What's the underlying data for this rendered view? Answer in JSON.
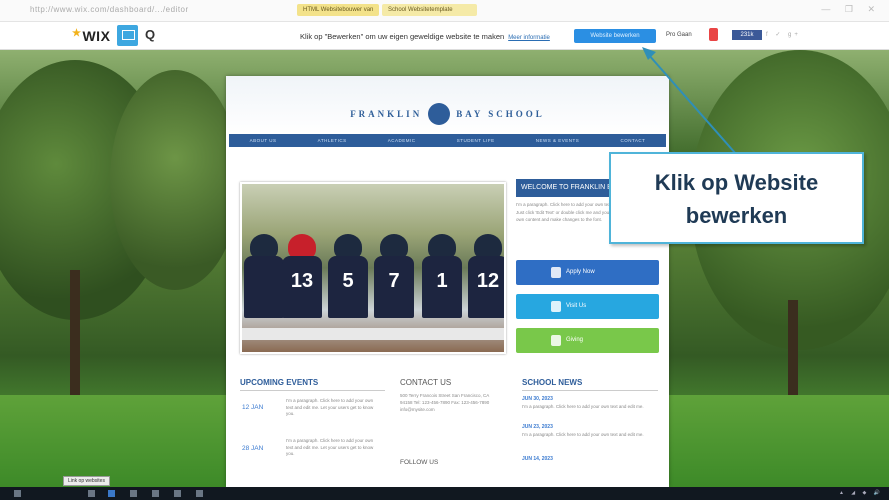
{
  "browser": {
    "url": "http://www.wix.com/dashboard/.../editor",
    "tab1": "HTML Websitebouwer van",
    "tab2": "School Websitetemplate",
    "window_controls": "— ❐ ✕"
  },
  "wix_bar": {
    "logo": "WIX",
    "q": "Q",
    "message": "Klik op \"Bewerken\" om uw eigen geweldige website te maken",
    "more_link": "Meer informatie",
    "edit_button": "Website bewerken",
    "premium": "Pro Gaan",
    "likes": "231k",
    "social": "f ✓ g+"
  },
  "site": {
    "brand_left": "FRANKLIN",
    "brand_right": "BAY SCHOOL",
    "nav": [
      "ABOUT US",
      "ATHLETICS",
      "ACADEMIC",
      "STUDENT LIFE",
      "NEWS & EVENTS",
      "CONTACT"
    ],
    "players": [
      "13",
      "5",
      "7",
      "1",
      "12"
    ],
    "welcome": "WELCOME TO FRANKLIN BAY",
    "paragraph": "I'm a paragraph. Click here to add your own text and edit me. It's easy. Just click 'Edit Text' or double click me and you can start adding your own content and make changes to the font.",
    "cta1": "Apply Now",
    "cta2": "Visit Us",
    "cta3": "Giving",
    "upcoming_title": "UPCOMING EVENTS",
    "events": [
      {
        "date": "12 JAN",
        "text": "I'm a paragraph. Click here to add your own text and edit me. Let your users get to know you."
      },
      {
        "date": "28 JAN",
        "text": "I'm a paragraph. Click here to add your own text and edit me. Let your users get to know you."
      }
    ],
    "contact_title": "CONTACT US",
    "contact_text": "500 Terry Francois Street San Francisco, CA 94158 Tel: 123-456-7890 Fax: 123-456-7890 info@mysite.com",
    "follow": "FOLLOW US",
    "news_title": "SCHOOL NEWS",
    "news": [
      {
        "date": "JUN 30, 2023",
        "text": "I'm a paragraph. Click here to add your own text and edit me."
      },
      {
        "date": "JUN 23, 2023",
        "text": "I'm a paragraph. Click here to add your own text and edit me."
      },
      {
        "date": "JUN 14, 2023",
        "text": ""
      }
    ]
  },
  "callout": {
    "line1": "Klik op Website",
    "line2": "bewerken"
  },
  "taskbar": {
    "tooltip": "Link op websites",
    "tray": "▲ ◢ ◆ 🔊"
  }
}
